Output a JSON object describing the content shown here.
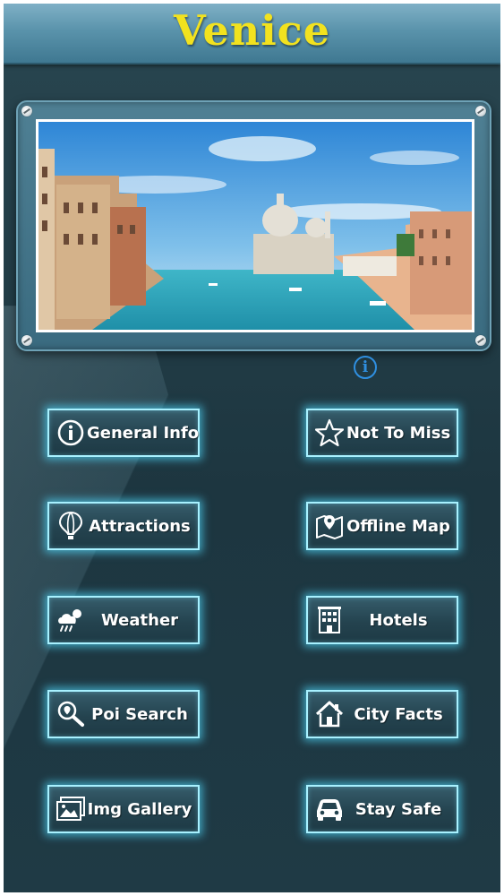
{
  "header": {
    "title": "Venice"
  },
  "hero": {
    "info_symbol": "i"
  },
  "menu": [
    {
      "label": "General Info",
      "icon": "info-circle-icon"
    },
    {
      "label": "Not To Miss",
      "icon": "star-icon"
    },
    {
      "label": "Attractions",
      "icon": "hot-air-balloon-icon"
    },
    {
      "label": "Offline Map",
      "icon": "map-pin-icon"
    },
    {
      "label": "Weather",
      "icon": "cloud-rain-icon"
    },
    {
      "label": "Hotels",
      "icon": "building-icon"
    },
    {
      "label": "Poi Search",
      "icon": "search-location-icon"
    },
    {
      "label": "City Facts",
      "icon": "house-icon"
    },
    {
      "label": "Img Gallery",
      "icon": "image-gallery-icon"
    },
    {
      "label": "Stay Safe",
      "icon": "car-icon"
    }
  ],
  "colors": {
    "title": "#f2e21f",
    "header": "#5a93ab",
    "background": "#1d3640",
    "button_glow": "#50dcff",
    "info_icon": "#2f8fe0"
  }
}
